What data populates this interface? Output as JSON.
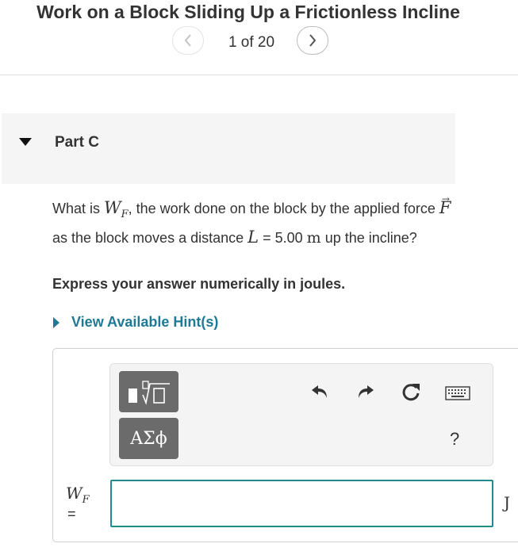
{
  "header": {
    "title": "Work on a Block Sliding Up a Frictionless Incline",
    "page_counter": "1 of 20"
  },
  "part": {
    "label": "Part C"
  },
  "question": {
    "t1": "What is ",
    "var_W": "W",
    "var_W_sub": "F",
    "t2": ", the work done on the block by the applied force ",
    "var_F": "F",
    "t3": " as the block moves a distance ",
    "var_L": "L",
    "t4": " = 5.00 ",
    "unit_m": "m",
    "t5": " up the incline?"
  },
  "instruction": "Express your answer numerically in joules.",
  "hint": {
    "label": "View Available Hint(s)"
  },
  "answer": {
    "symbols_label": "ΑΣϕ",
    "help_label": "?",
    "var_label": "W",
    "var_sub": "F",
    "equals": "=",
    "input_value": "",
    "input_placeholder": "",
    "unit": "J"
  },
  "colors": {
    "accent": "#1e7a94",
    "input_border": "#1e8c8c",
    "toolbar_button": "#6b6b6b"
  },
  "icons": {
    "prev": "chevron-left-icon",
    "next": "chevron-right-icon",
    "collapse": "triangle-down-icon",
    "hint": "triangle-right-icon",
    "undo": "undo-icon",
    "redo": "redo-icon",
    "reset": "reset-icon",
    "keyboard": "keyboard-icon"
  }
}
